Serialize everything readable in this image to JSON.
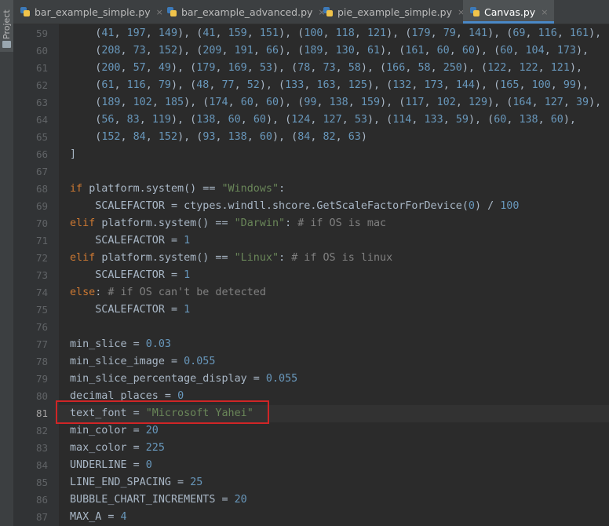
{
  "sidebar": {
    "project_label": "Project"
  },
  "tabs": [
    {
      "label": "bar_example_simple.py",
      "active": false
    },
    {
      "label": "bar_example_advanced.py",
      "active": false
    },
    {
      "label": "pie_example_simple.py",
      "active": false
    },
    {
      "label": "Canvas.py",
      "active": true
    }
  ],
  "tab_close_glyph": "×",
  "current_line": "81",
  "highlighted_line": "81",
  "syntax_colors": {
    "keyword": "#cc7832",
    "number": "#6897bb",
    "string": "#6a8759",
    "comment": "#808080",
    "text": "#a9b7c6"
  },
  "lines": [
    {
      "n": "59",
      "tokens": [
        [
          "t",
          "    ("
        ],
        [
          "n",
          "41"
        ],
        [
          "t",
          ", "
        ],
        [
          "n",
          "197"
        ],
        [
          "t",
          ", "
        ],
        [
          "n",
          "149"
        ],
        [
          "t",
          "), ("
        ],
        [
          "n",
          "41"
        ],
        [
          "t",
          ", "
        ],
        [
          "n",
          "159"
        ],
        [
          "t",
          ", "
        ],
        [
          "n",
          "151"
        ],
        [
          "t",
          "), ("
        ],
        [
          "n",
          "100"
        ],
        [
          "t",
          ", "
        ],
        [
          "n",
          "118"
        ],
        [
          "t",
          ", "
        ],
        [
          "n",
          "121"
        ],
        [
          "t",
          "), ("
        ],
        [
          "n",
          "179"
        ],
        [
          "t",
          ", "
        ],
        [
          "n",
          "79"
        ],
        [
          "t",
          ", "
        ],
        [
          "n",
          "141"
        ],
        [
          "t",
          "), ("
        ],
        [
          "n",
          "69"
        ],
        [
          "t",
          ", "
        ],
        [
          "n",
          "116"
        ],
        [
          "t",
          ", "
        ],
        [
          "n",
          "161"
        ],
        [
          "t",
          "),"
        ]
      ]
    },
    {
      "n": "60",
      "tokens": [
        [
          "t",
          "    ("
        ],
        [
          "n",
          "208"
        ],
        [
          "t",
          ", "
        ],
        [
          "n",
          "73"
        ],
        [
          "t",
          ", "
        ],
        [
          "n",
          "152"
        ],
        [
          "t",
          "), ("
        ],
        [
          "n",
          "209"
        ],
        [
          "t",
          ", "
        ],
        [
          "n",
          "191"
        ],
        [
          "t",
          ", "
        ],
        [
          "n",
          "66"
        ],
        [
          "t",
          "), ("
        ],
        [
          "n",
          "189"
        ],
        [
          "t",
          ", "
        ],
        [
          "n",
          "130"
        ],
        [
          "t",
          ", "
        ],
        [
          "n",
          "61"
        ],
        [
          "t",
          "), ("
        ],
        [
          "n",
          "161"
        ],
        [
          "t",
          ", "
        ],
        [
          "n",
          "60"
        ],
        [
          "t",
          ", "
        ],
        [
          "n",
          "60"
        ],
        [
          "t",
          "), ("
        ],
        [
          "n",
          "60"
        ],
        [
          "t",
          ", "
        ],
        [
          "n",
          "104"
        ],
        [
          "t",
          ", "
        ],
        [
          "n",
          "173"
        ],
        [
          "t",
          "),"
        ]
      ]
    },
    {
      "n": "61",
      "tokens": [
        [
          "t",
          "    ("
        ],
        [
          "n",
          "200"
        ],
        [
          "t",
          ", "
        ],
        [
          "n",
          "57"
        ],
        [
          "t",
          ", "
        ],
        [
          "n",
          "49"
        ],
        [
          "t",
          "), ("
        ],
        [
          "n",
          "179"
        ],
        [
          "t",
          ", "
        ],
        [
          "n",
          "169"
        ],
        [
          "t",
          ", "
        ],
        [
          "n",
          "53"
        ],
        [
          "t",
          "), ("
        ],
        [
          "n",
          "78"
        ],
        [
          "t",
          ", "
        ],
        [
          "n",
          "73"
        ],
        [
          "t",
          ", "
        ],
        [
          "n",
          "58"
        ],
        [
          "t",
          "), ("
        ],
        [
          "n",
          "166"
        ],
        [
          "t",
          ", "
        ],
        [
          "n",
          "58"
        ],
        [
          "t",
          ", "
        ],
        [
          "n",
          "250"
        ],
        [
          "t",
          "), ("
        ],
        [
          "n",
          "122"
        ],
        [
          "t",
          ", "
        ],
        [
          "n",
          "122"
        ],
        [
          "t",
          ", "
        ],
        [
          "n",
          "121"
        ],
        [
          "t",
          "),"
        ]
      ]
    },
    {
      "n": "62",
      "tokens": [
        [
          "t",
          "    ("
        ],
        [
          "n",
          "61"
        ],
        [
          "t",
          ", "
        ],
        [
          "n",
          "116"
        ],
        [
          "t",
          ", "
        ],
        [
          "n",
          "79"
        ],
        [
          "t",
          "), ("
        ],
        [
          "n",
          "48"
        ],
        [
          "t",
          ", "
        ],
        [
          "n",
          "77"
        ],
        [
          "t",
          ", "
        ],
        [
          "n",
          "52"
        ],
        [
          "t",
          "), ("
        ],
        [
          "n",
          "133"
        ],
        [
          "t",
          ", "
        ],
        [
          "n",
          "163"
        ],
        [
          "t",
          ", "
        ],
        [
          "n",
          "125"
        ],
        [
          "t",
          "), ("
        ],
        [
          "n",
          "132"
        ],
        [
          "t",
          ", "
        ],
        [
          "n",
          "173"
        ],
        [
          "t",
          ", "
        ],
        [
          "n",
          "144"
        ],
        [
          "t",
          "), ("
        ],
        [
          "n",
          "165"
        ],
        [
          "t",
          ", "
        ],
        [
          "n",
          "100"
        ],
        [
          "t",
          ", "
        ],
        [
          "n",
          "99"
        ],
        [
          "t",
          "),"
        ]
      ]
    },
    {
      "n": "63",
      "tokens": [
        [
          "t",
          "    ("
        ],
        [
          "n",
          "189"
        ],
        [
          "t",
          ", "
        ],
        [
          "n",
          "102"
        ],
        [
          "t",
          ", "
        ],
        [
          "n",
          "185"
        ],
        [
          "t",
          "), ("
        ],
        [
          "n",
          "174"
        ],
        [
          "t",
          ", "
        ],
        [
          "n",
          "60"
        ],
        [
          "t",
          ", "
        ],
        [
          "n",
          "60"
        ],
        [
          "t",
          "), ("
        ],
        [
          "n",
          "99"
        ],
        [
          "t",
          ", "
        ],
        [
          "n",
          "138"
        ],
        [
          "t",
          ", "
        ],
        [
          "n",
          "159"
        ],
        [
          "t",
          "), ("
        ],
        [
          "n",
          "117"
        ],
        [
          "t",
          ", "
        ],
        [
          "n",
          "102"
        ],
        [
          "t",
          ", "
        ],
        [
          "n",
          "129"
        ],
        [
          "t",
          "), ("
        ],
        [
          "n",
          "164"
        ],
        [
          "t",
          ", "
        ],
        [
          "n",
          "127"
        ],
        [
          "t",
          ", "
        ],
        [
          "n",
          "39"
        ],
        [
          "t",
          "),"
        ]
      ]
    },
    {
      "n": "64",
      "tokens": [
        [
          "t",
          "    ("
        ],
        [
          "n",
          "56"
        ],
        [
          "t",
          ", "
        ],
        [
          "n",
          "83"
        ],
        [
          "t",
          ", "
        ],
        [
          "n",
          "119"
        ],
        [
          "t",
          "), ("
        ],
        [
          "n",
          "138"
        ],
        [
          "t",
          ", "
        ],
        [
          "n",
          "60"
        ],
        [
          "t",
          ", "
        ],
        [
          "n",
          "60"
        ],
        [
          "t",
          "), ("
        ],
        [
          "n",
          "124"
        ],
        [
          "t",
          ", "
        ],
        [
          "n",
          "127"
        ],
        [
          "t",
          ", "
        ],
        [
          "n",
          "53"
        ],
        [
          "t",
          "), ("
        ],
        [
          "n",
          "114"
        ],
        [
          "t",
          ", "
        ],
        [
          "n",
          "133"
        ],
        [
          "t",
          ", "
        ],
        [
          "n",
          "59"
        ],
        [
          "t",
          "), ("
        ],
        [
          "n",
          "60"
        ],
        [
          "t",
          ", "
        ],
        [
          "n",
          "138"
        ],
        [
          "t",
          ", "
        ],
        [
          "n",
          "60"
        ],
        [
          "t",
          "),"
        ]
      ]
    },
    {
      "n": "65",
      "tokens": [
        [
          "t",
          "    ("
        ],
        [
          "n",
          "152"
        ],
        [
          "t",
          ", "
        ],
        [
          "n",
          "84"
        ],
        [
          "t",
          ", "
        ],
        [
          "n",
          "152"
        ],
        [
          "t",
          "), ("
        ],
        [
          "n",
          "93"
        ],
        [
          "t",
          ", "
        ],
        [
          "n",
          "138"
        ],
        [
          "t",
          ", "
        ],
        [
          "n",
          "60"
        ],
        [
          "t",
          "), ("
        ],
        [
          "n",
          "84"
        ],
        [
          "t",
          ", "
        ],
        [
          "n",
          "82"
        ],
        [
          "t",
          ", "
        ],
        [
          "n",
          "63"
        ],
        [
          "t",
          ")"
        ]
      ]
    },
    {
      "n": "66",
      "tokens": [
        [
          "t",
          "]"
        ]
      ]
    },
    {
      "n": "67",
      "tokens": []
    },
    {
      "n": "68",
      "tokens": [
        [
          "k",
          "if "
        ],
        [
          "t",
          "platform.system() == "
        ],
        [
          "s",
          "\"Windows\""
        ],
        [
          "t",
          ":"
        ]
      ]
    },
    {
      "n": "69",
      "tokens": [
        [
          "t",
          "    SCALEFACTOR = ctypes.windll.shcore.GetScaleFactorForDevice("
        ],
        [
          "n",
          "0"
        ],
        [
          "t",
          ") / "
        ],
        [
          "n",
          "100"
        ]
      ]
    },
    {
      "n": "70",
      "tokens": [
        [
          "k",
          "elif "
        ],
        [
          "t",
          "platform.system() == "
        ],
        [
          "s",
          "\"Darwin\""
        ],
        [
          "t",
          ": "
        ],
        [
          "c",
          "# if OS is mac"
        ]
      ]
    },
    {
      "n": "71",
      "tokens": [
        [
          "t",
          "    SCALEFACTOR = "
        ],
        [
          "n",
          "1"
        ]
      ]
    },
    {
      "n": "72",
      "tokens": [
        [
          "k",
          "elif "
        ],
        [
          "t",
          "platform.system() == "
        ],
        [
          "s",
          "\"Linux\""
        ],
        [
          "t",
          ": "
        ],
        [
          "c",
          "# if OS is linux"
        ]
      ]
    },
    {
      "n": "73",
      "tokens": [
        [
          "t",
          "    SCALEFACTOR = "
        ],
        [
          "n",
          "1"
        ]
      ]
    },
    {
      "n": "74",
      "tokens": [
        [
          "k",
          "else"
        ],
        [
          "t",
          ": "
        ],
        [
          "c",
          "# if OS can't be detected"
        ]
      ]
    },
    {
      "n": "75",
      "tokens": [
        [
          "t",
          "    SCALEFACTOR = "
        ],
        [
          "n",
          "1"
        ]
      ]
    },
    {
      "n": "76",
      "tokens": []
    },
    {
      "n": "77",
      "tokens": [
        [
          "t",
          "min_slice = "
        ],
        [
          "n",
          "0.03"
        ]
      ]
    },
    {
      "n": "78",
      "tokens": [
        [
          "t",
          "min_slice_image = "
        ],
        [
          "n",
          "0.055"
        ]
      ]
    },
    {
      "n": "79",
      "tokens": [
        [
          "t",
          "min_slice_percentage_display = "
        ],
        [
          "n",
          "0.055"
        ]
      ]
    },
    {
      "n": "80",
      "tokens": [
        [
          "t",
          "decimal_places = "
        ],
        [
          "n",
          "0"
        ]
      ]
    },
    {
      "n": "81",
      "tokens": [
        [
          "t",
          "text_font = "
        ],
        [
          "s",
          "\"Microsoft Yahei\""
        ]
      ]
    },
    {
      "n": "82",
      "tokens": [
        [
          "t",
          "min_color = "
        ],
        [
          "n",
          "20"
        ]
      ]
    },
    {
      "n": "83",
      "tokens": [
        [
          "t",
          "max_color = "
        ],
        [
          "n",
          "225"
        ]
      ]
    },
    {
      "n": "84",
      "tokens": [
        [
          "t",
          "UNDERLINE = "
        ],
        [
          "n",
          "0"
        ]
      ]
    },
    {
      "n": "85",
      "tokens": [
        [
          "t",
          "LINE_END_SPACING = "
        ],
        [
          "n",
          "25"
        ]
      ]
    },
    {
      "n": "86",
      "tokens": [
        [
          "t",
          "BUBBLE_CHART_INCREMENTS = "
        ],
        [
          "n",
          "20"
        ]
      ]
    },
    {
      "n": "87",
      "tokens": [
        [
          "t",
          "MAX_A = "
        ],
        [
          "n",
          "4"
        ]
      ]
    }
  ]
}
